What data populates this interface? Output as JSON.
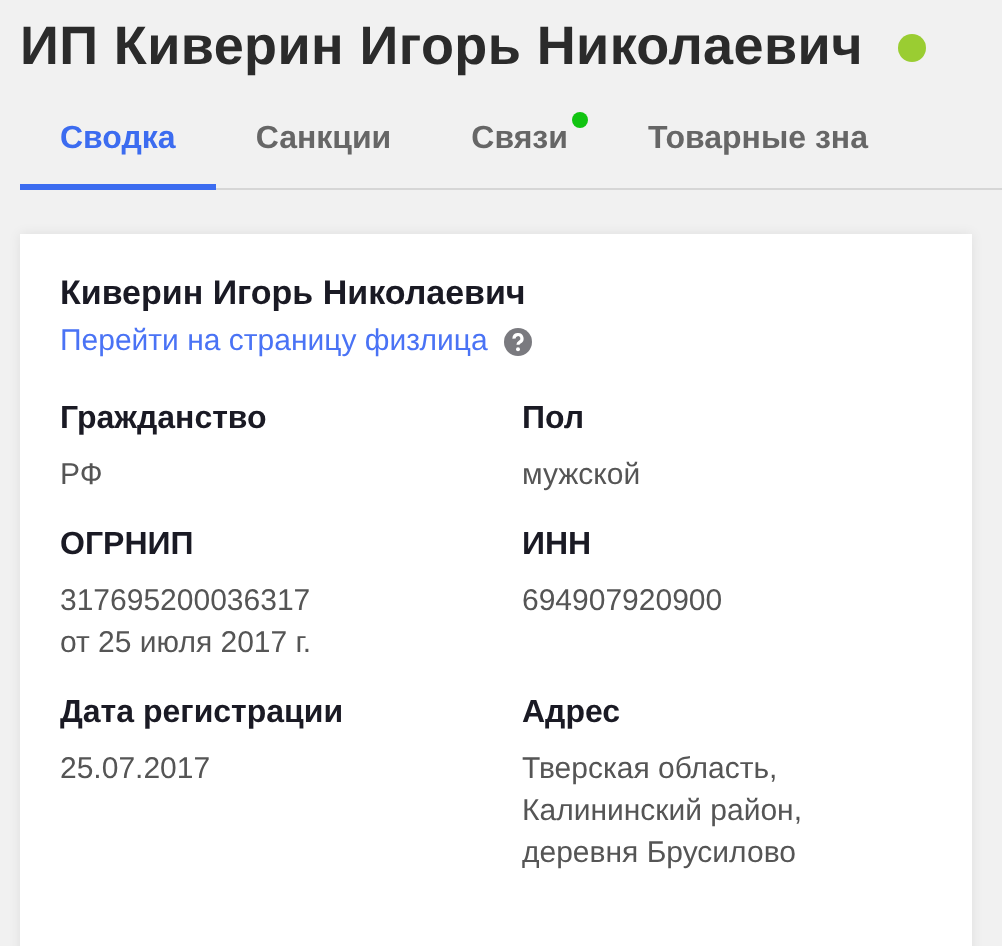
{
  "title": "ИП Киверин Игорь Николаевич",
  "status": {
    "color": "#9acd32"
  },
  "tabs": [
    {
      "label": "Сводка",
      "selected": true,
      "dot": false
    },
    {
      "label": "Санкции",
      "selected": false,
      "dot": false
    },
    {
      "label": "Связи",
      "selected": false,
      "dot": true
    },
    {
      "label": "Товарные зна",
      "selected": false,
      "dot": false
    }
  ],
  "card": {
    "name": "Киверин Игорь Николаевич",
    "link": "Перейти на страницу физлица",
    "fields": [
      {
        "label": "Гражданство",
        "lines": [
          "РФ"
        ]
      },
      {
        "label": "Пол",
        "lines": [
          "мужской"
        ]
      },
      {
        "label": "ОГРНИП",
        "lines": [
          "317695200036317",
          "от 25 июля 2017 г."
        ]
      },
      {
        "label": "ИНН",
        "lines": [
          "694907920900"
        ]
      },
      {
        "label": "Дата регистрации",
        "lines": [
          "25.07.2017"
        ]
      },
      {
        "label": "Адрес",
        "lines": [
          "Тверская область,",
          "Калининский район,",
          "деревня Брусилово"
        ]
      }
    ]
  }
}
